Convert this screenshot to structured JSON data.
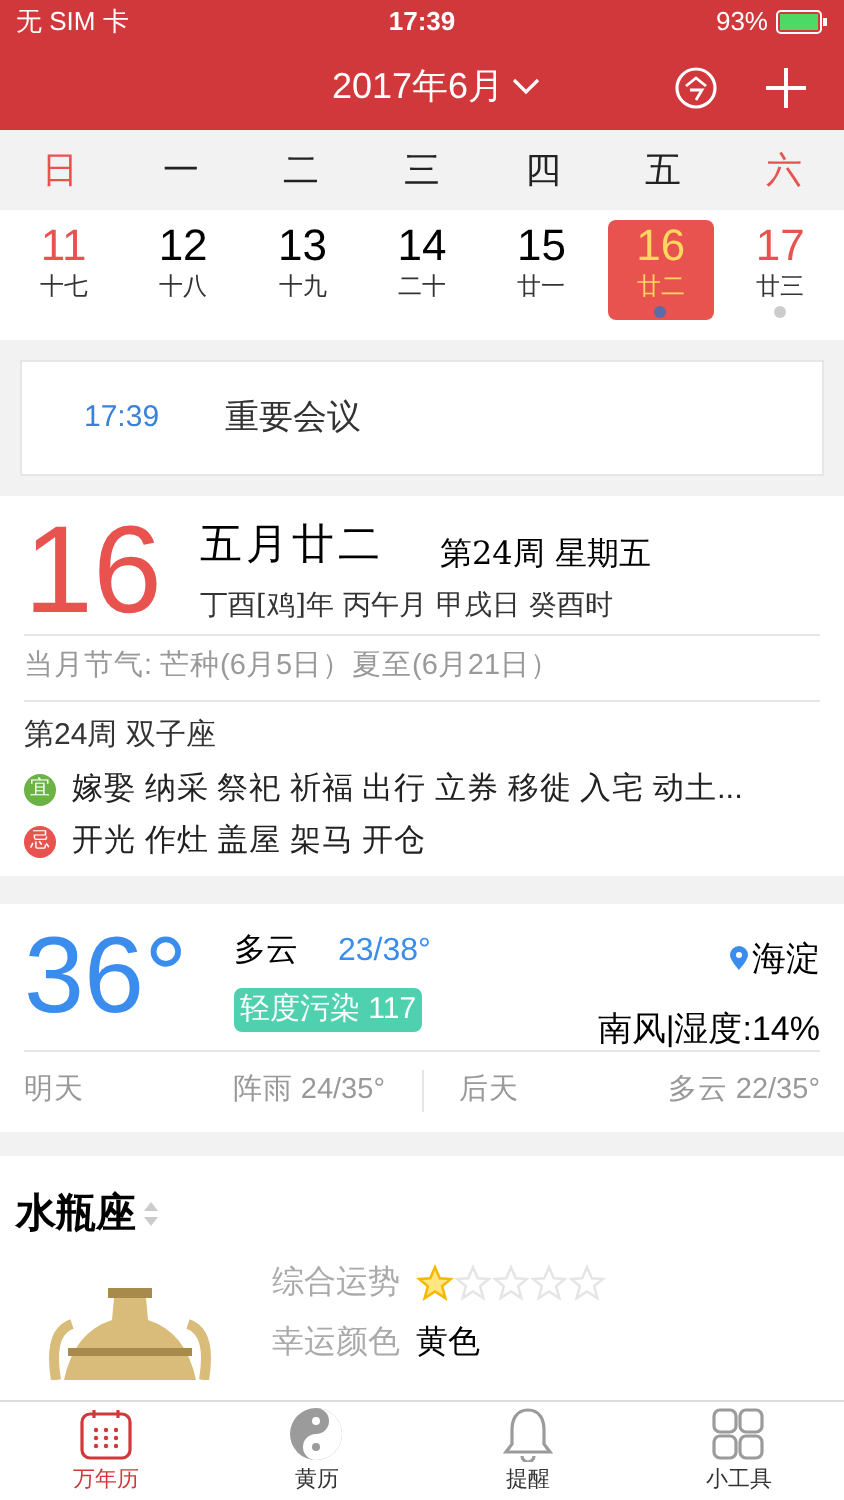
{
  "status_bar": {
    "carrier": "无 SIM 卡",
    "time": "17:39",
    "battery": "93%"
  },
  "header": {
    "title": "2017年6月"
  },
  "weekdays": [
    {
      "label": "日",
      "weekend": true
    },
    {
      "label": "一",
      "weekend": false
    },
    {
      "label": "二",
      "weekend": false
    },
    {
      "label": "三",
      "weekend": false
    },
    {
      "label": "四",
      "weekend": false
    },
    {
      "label": "五",
      "weekend": false
    },
    {
      "label": "六",
      "weekend": true
    }
  ],
  "days": [
    {
      "day": "11",
      "lunar": "十七",
      "weekend": true,
      "selected": false,
      "has_event": false
    },
    {
      "day": "12",
      "lunar": "十八",
      "weekend": false,
      "selected": false,
      "has_event": false
    },
    {
      "day": "13",
      "lunar": "十九",
      "weekend": false,
      "selected": false,
      "has_event": false
    },
    {
      "day": "14",
      "lunar": "二十",
      "weekend": false,
      "selected": false,
      "has_event": false
    },
    {
      "day": "15",
      "lunar": "廿一",
      "weekend": false,
      "selected": false,
      "has_event": false
    },
    {
      "day": "16",
      "lunar": "廿二",
      "weekend": false,
      "selected": true,
      "has_event": true
    },
    {
      "day": "17",
      "lunar": "廿三",
      "weekend": true,
      "selected": false,
      "has_event": true
    }
  ],
  "event": {
    "time": "17:39",
    "title": "重要会议"
  },
  "almanac": {
    "day": "16",
    "lunar_date": "五月廿二",
    "week": "第24周 星期五",
    "ganzhi": "丁酉[鸡]年 丙午月 甲戌日 癸酉时",
    "solar_terms": "当月节气: 芒种(6月5日）夏至(6月21日）",
    "week_sign": "第24周 双子座",
    "items": [
      {
        "badge": "宜",
        "text": "嫁娶 纳采 祭祀 祈福 出行 立券 移徙 入宅 动土...",
        "color": "#6ab344"
      },
      {
        "badge": "忌",
        "text": "开光 作灶 盖屋 架马 开仓",
        "color": "#e8524f"
      }
    ]
  },
  "weather": {
    "temperature": "36°",
    "condition": "多云",
    "range": "23/38°",
    "air_quality": "轻度污染 117",
    "location": "海淀",
    "wind_humidity": "南风|湿度:14%",
    "forecast": [
      {
        "day": "明天",
        "summary": "阵雨 24/35°"
      },
      {
        "day": "后天",
        "summary": "多云 22/35°"
      }
    ]
  },
  "horoscope": {
    "sign": "水瓶座",
    "rows": [
      {
        "label": "综合运势",
        "kind": "stars",
        "stars": 1
      },
      {
        "label": "幸运颜色",
        "kind": "text",
        "value": "黄色"
      }
    ]
  },
  "tabs": [
    {
      "label": "万年历",
      "selected": true
    },
    {
      "label": "黄历",
      "selected": false
    },
    {
      "label": "提醒",
      "selected": false
    },
    {
      "label": "小工具",
      "selected": false
    }
  ]
}
